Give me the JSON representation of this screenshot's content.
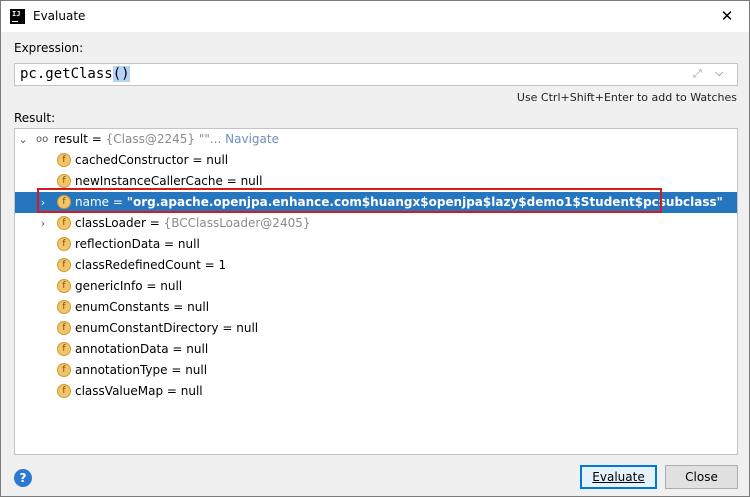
{
  "window": {
    "title": "Evaluate",
    "app_icon": "intellij-icon",
    "close_label": "✕"
  },
  "expression": {
    "label": "Expression:",
    "value_prefix": "pc.getClass",
    "value_parens": "()",
    "hint": "Use Ctrl+Shift+Enter to add to Watches"
  },
  "result": {
    "label": "Result:",
    "root": {
      "name": "result",
      "eq": " = ",
      "value": "{Class@2245} \"\"",
      "ellipsis": "...",
      "navigate": "Navigate"
    },
    "fields": [
      {
        "name": "cachedConstructor",
        "value": "null",
        "expandable": false
      },
      {
        "name": "newInstanceCallerCache",
        "value": "null",
        "expandable": false
      },
      {
        "name": "name",
        "value": "\"org.apache.openjpa.enhance.com$huangx$openjpa$lazy$demo1$Student$pcsubclass\"",
        "expandable": true,
        "selected": true
      },
      {
        "name": "classLoader",
        "value": "{BCClassLoader@2405}",
        "expandable": true
      },
      {
        "name": "reflectionData",
        "value": "null",
        "expandable": false
      },
      {
        "name": "classRedefinedCount",
        "value": "1",
        "expandable": false
      },
      {
        "name": "genericInfo",
        "value": "null",
        "expandable": false
      },
      {
        "name": "enumConstants",
        "value": "null",
        "expandable": false
      },
      {
        "name": "enumConstantDirectory",
        "value": "null",
        "expandable": false
      },
      {
        "name": "annotationData",
        "value": "null",
        "expandable": false
      },
      {
        "name": "annotationType",
        "value": "null",
        "expandable": false
      },
      {
        "name": "classValueMap",
        "value": "null",
        "expandable": false
      }
    ],
    "field_badge": "f"
  },
  "footer": {
    "help_label": "?",
    "evaluate_label": "Evaluate",
    "close_label": "Close"
  },
  "colors": {
    "selection": "#2675bf",
    "highlight": "#d71920",
    "badge": "#f2c46b"
  }
}
